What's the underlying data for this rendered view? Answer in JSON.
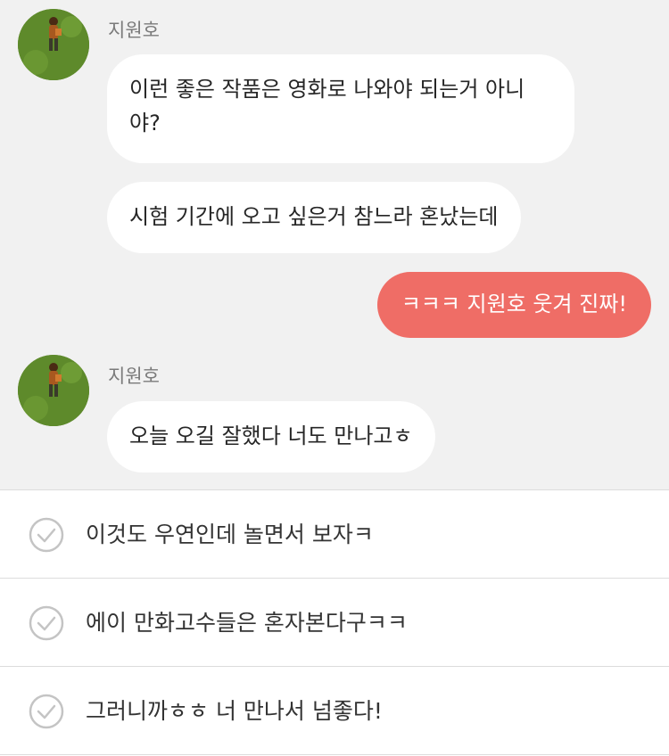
{
  "messages": [
    {
      "sender": "지원호",
      "text": "이런 좋은 작품은 영화로 나와야 되는거 아니야?"
    },
    {
      "text": "시험 기간에 오고 싶은거 참느라 혼났는데"
    },
    {
      "mine": true,
      "text": "ㅋㅋㅋ 지원호 웃겨 진짜!"
    },
    {
      "sender": "지원호",
      "text": "오늘 오길 잘했다 너도 만나고ㅎ"
    }
  ],
  "reply_options": [
    {
      "icon": "check-circle-icon",
      "text": "이것도 우연인데 놀면서 보자ㅋ"
    },
    {
      "icon": "check-circle-icon",
      "text": "에이 만화고수들은 혼자본다구ㅋㅋ"
    },
    {
      "icon": "check-circle-icon",
      "text": "그러니까ㅎㅎ 너 만나서 넘좋다!"
    }
  ],
  "colors": {
    "chat_background": "#f1f1f1",
    "incoming_bubble": "#ffffff",
    "outgoing_bubble": "#ef6d66",
    "check_icon": "#c4c4c4"
  }
}
